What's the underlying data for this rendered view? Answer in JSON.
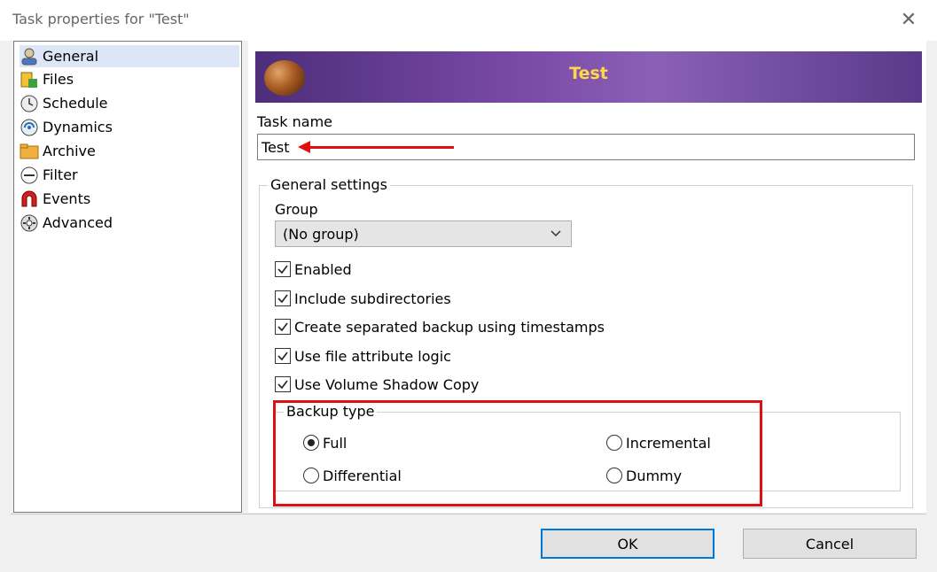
{
  "window": {
    "title": "Task properties for \"Test\""
  },
  "sidebar": {
    "items": [
      {
        "label": "General",
        "icon": "general-user-icon",
        "selected": true
      },
      {
        "label": "Files",
        "icon": "files-icon"
      },
      {
        "label": "Schedule",
        "icon": "schedule-clock-icon"
      },
      {
        "label": "Dynamics",
        "icon": "dynamics-icon"
      },
      {
        "label": "Archive",
        "icon": "archive-folder-icon"
      },
      {
        "label": "Filter",
        "icon": "filter-icon"
      },
      {
        "label": "Events",
        "icon": "events-magnet-icon"
      },
      {
        "label": "Advanced",
        "icon": "advanced-gear-icon"
      }
    ]
  },
  "banner": {
    "title": "Test"
  },
  "task_name": {
    "label": "Task name",
    "value": "Test"
  },
  "general_settings": {
    "label": "General settings",
    "group_label": "Group",
    "group_value": "(No group)",
    "checkboxes": [
      {
        "label": "Enabled",
        "checked": true
      },
      {
        "label": "Include subdirectories",
        "checked": true
      },
      {
        "label": "Create separated backup using timestamps",
        "checked": true
      },
      {
        "label": "Use file attribute logic",
        "checked": true
      },
      {
        "label": "Use Volume Shadow Copy",
        "checked": true
      }
    ]
  },
  "backup_type": {
    "label": "Backup type",
    "options": [
      {
        "label": "Full",
        "checked": true
      },
      {
        "label": "Incremental",
        "checked": false
      },
      {
        "label": "Differential",
        "checked": false
      },
      {
        "label": "Dummy",
        "checked": false
      }
    ]
  },
  "buttons": {
    "ok": "OK",
    "cancel": "Cancel"
  },
  "colors": {
    "annotation": "#e01010",
    "banner_text": "#ffd84a",
    "focus": "#0078d7"
  }
}
